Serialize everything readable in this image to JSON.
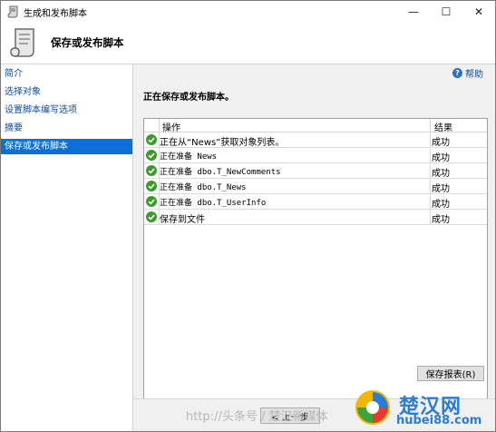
{
  "window": {
    "title": "生成和发布脚本",
    "controls": [
      "—",
      "☐",
      "✕"
    ]
  },
  "header": {
    "title": "保存或发布脚本"
  },
  "nav": {
    "items": [
      {
        "label": "简介"
      },
      {
        "label": "选择对象"
      },
      {
        "label": "设置脚本编写选项"
      },
      {
        "label": "摘要"
      },
      {
        "label": "保存或发布脚本",
        "selected": true
      }
    ]
  },
  "help": {
    "label": "帮助",
    "icon": "help-icon"
  },
  "status_heading": "正在保存或发布脚本。",
  "table": {
    "columns": [
      "操作",
      "结果"
    ],
    "rows": [
      {
        "operation": "正在从“News”获取对象列表。",
        "result": "成功",
        "status_icon": "success-check-icon"
      },
      {
        "operation": "正在准备 News",
        "result": "成功",
        "status_icon": "success-check-icon"
      },
      {
        "operation": "正在准备 dbo.T_NewComments",
        "result": "成功",
        "status_icon": "success-check-icon"
      },
      {
        "operation": "正在准备 dbo.T_News",
        "result": "成功",
        "status_icon": "success-check-icon"
      },
      {
        "operation": "正在准备 dbo.T_UserInfo",
        "result": "成功",
        "status_icon": "success-check-icon"
      },
      {
        "operation": "保存到文件",
        "result": "成功",
        "status_icon": "success-check-icon"
      }
    ]
  },
  "buttons": {
    "save_report": "保存报表(R)",
    "previous": "< 上一步"
  },
  "watermark": {
    "text": "http://头条号 / 楚汉新媒体",
    "brand": "楚汉网",
    "domain": "hubei88.com"
  },
  "colors": {
    "selection": "#0a6fd6",
    "link": "#0b4ca8",
    "success": "#3d9a2c"
  }
}
